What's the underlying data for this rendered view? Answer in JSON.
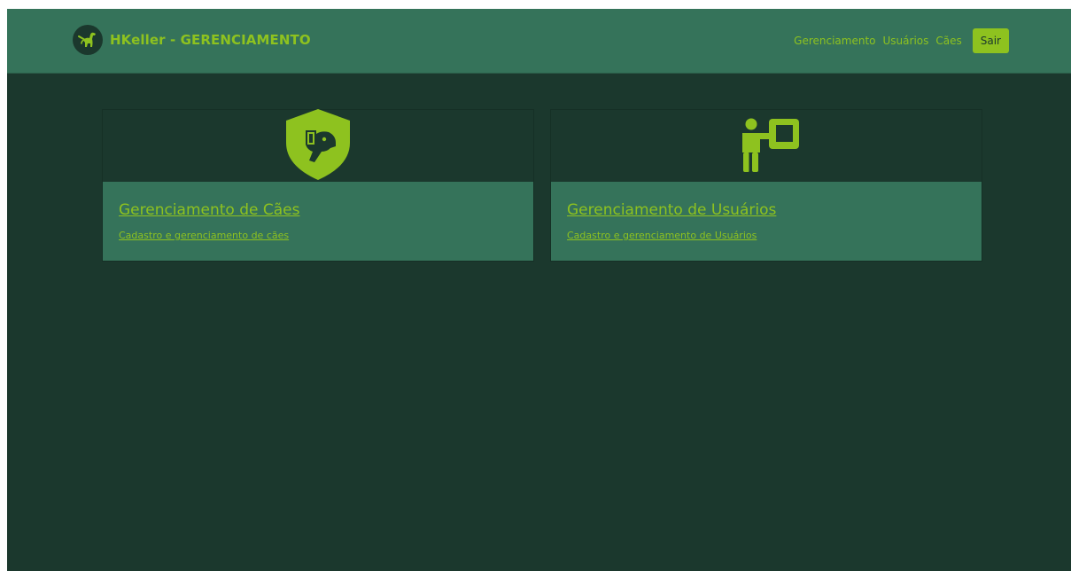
{
  "header": {
    "brand": "HKeller - GERENCIAMENTO",
    "logo_icon": "guide-dog-icon",
    "nav": [
      {
        "label": "Gerenciamento"
      },
      {
        "label": "Usuários"
      },
      {
        "label": "Cães"
      }
    ],
    "logout_label": "Sair"
  },
  "cards": [
    {
      "icon": "dog-shield-icon",
      "title": "Gerenciamento de Cães",
      "subtitle": "Cadastro e gerenciamento de cães"
    },
    {
      "icon": "presenter-board-icon",
      "title": "Gerenciamento de Usuários",
      "subtitle": "Cadastro e gerenciamento de Usuários"
    }
  ],
  "colors": {
    "page_bg": "#1b382d",
    "navbar_bg": "#35735a",
    "accent": "#8ec21f"
  }
}
